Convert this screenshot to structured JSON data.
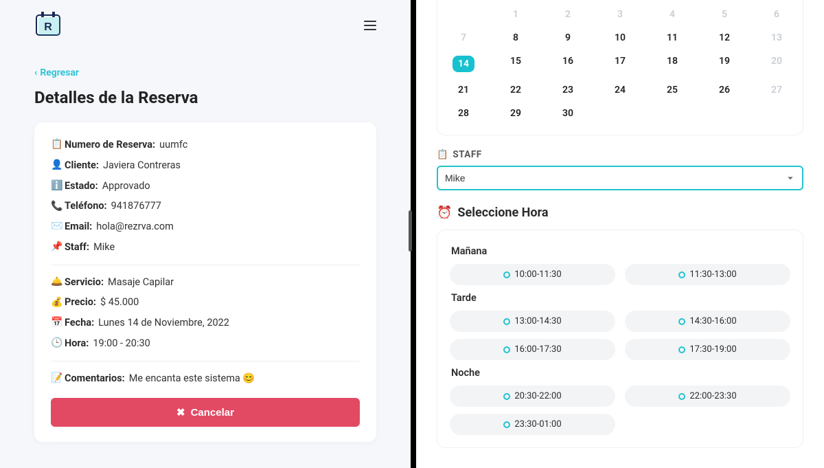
{
  "left": {
    "back_label": "Regresar",
    "title": "Detalles de la Reserva",
    "fields": {
      "res_num_label": "Numero de Reserva:",
      "res_num_val": "uumfc",
      "client_label": "Cliente:",
      "client_val": "Javiera Contreras",
      "state_label": "Estado:",
      "state_val": "Approvado",
      "phone_label": "Teléfono:",
      "phone_val": "941876777",
      "email_label": "Email:",
      "email_val": "hola@rezrva.com",
      "staff_label": "Staff:",
      "staff_val": "Mike",
      "service_label": "Servicio:",
      "service_val": "Masaje Capilar",
      "price_label": "Precio:",
      "price_val": "$ 45.000",
      "date_label": "Fecha:",
      "date_val": "Lunes 14 de Noviembre, 2022",
      "time_label": "Hora:",
      "time_val": "19:00 - 20:30",
      "comments_label": "Comentarios:",
      "comments_val": "Me encanta este sistema 😊"
    },
    "cancel_label": "Cancelar"
  },
  "right": {
    "calendar": {
      "selected": 14,
      "rows": [
        [
          {
            "n": 1,
            "m": true
          },
          {
            "n": 2,
            "m": true
          },
          {
            "n": 3,
            "m": true
          },
          {
            "n": 4,
            "m": true
          },
          {
            "n": 5,
            "m": true
          },
          {
            "n": 6,
            "m": true
          }
        ],
        [
          {
            "n": 7,
            "m": true
          },
          {
            "n": 8
          },
          {
            "n": 9
          },
          {
            "n": 10
          },
          {
            "n": 11
          },
          {
            "n": 12
          },
          {
            "n": 13,
            "m": true
          }
        ],
        [
          {
            "n": 14,
            "sel": true
          },
          {
            "n": 15
          },
          {
            "n": 16
          },
          {
            "n": 17
          },
          {
            "n": 18
          },
          {
            "n": 19
          },
          {
            "n": 20,
            "m": true
          }
        ],
        [
          {
            "n": 21
          },
          {
            "n": 22
          },
          {
            "n": 23
          },
          {
            "n": 24
          },
          {
            "n": 25
          },
          {
            "n": 26
          },
          {
            "n": 27,
            "m": true
          }
        ],
        [
          {
            "n": 28
          },
          {
            "n": 29
          },
          {
            "n": 30
          }
        ]
      ]
    },
    "staff_label": "STAFF",
    "staff_selected": "Mike",
    "hour_title": "Seleccione Hora",
    "periods": [
      {
        "label": "Mañana",
        "slots": [
          "10:00-11:30",
          "11:30-13:00"
        ]
      },
      {
        "label": "Tarde",
        "slots": [
          "13:00-14:30",
          "14:30-16:00",
          "16:00-17:30",
          "17:30-19:00"
        ]
      },
      {
        "label": "Noche",
        "slots": [
          "20:30-22:00",
          "22:00-23:30",
          "23:30-01:00"
        ]
      }
    ]
  }
}
